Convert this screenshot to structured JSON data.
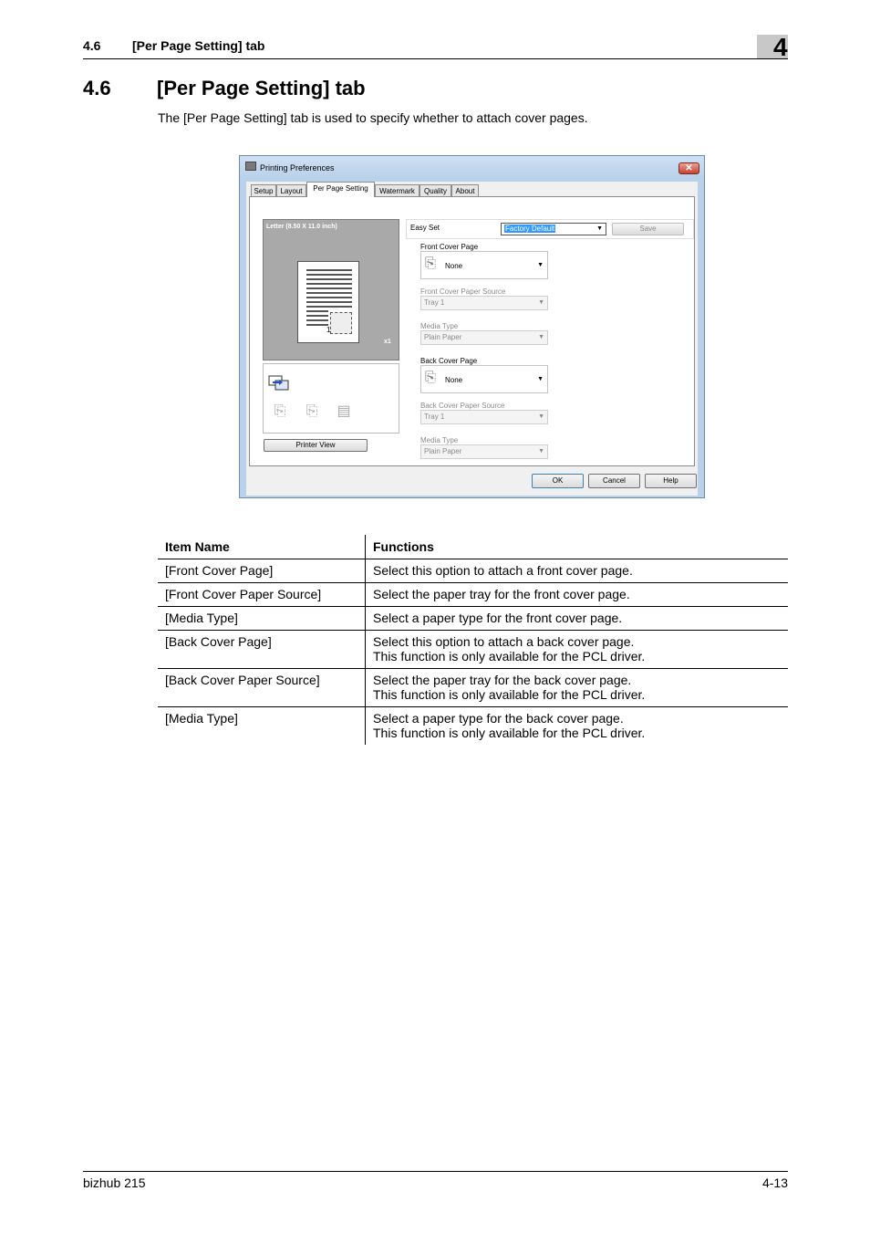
{
  "header": {
    "section_number": "4.6",
    "section_title": "[Per Page Setting] tab",
    "chapter_number": "4"
  },
  "section": {
    "number": "4.6",
    "title": "[Per Page Setting] tab",
    "intro": "The [Per Page Setting] tab is used to specify whether to attach cover pages."
  },
  "dialog": {
    "title": "Printing Preferences",
    "close_glyph": "✕",
    "tabs": [
      "Setup",
      "Layout",
      "Per Page Setting",
      "Watermark",
      "Quality",
      "About"
    ],
    "active_tab": "Per Page Setting",
    "preview": {
      "paper_label": "Letter  (8.50 X 11.0 inch)",
      "copies": "x1",
      "page_number": "1"
    },
    "printer_view_label": "Printer View",
    "easy_set_label": "Easy Set",
    "easy_set_value": "Factory Default",
    "save_label": "Save",
    "front_cover_page_label": "Front Cover Page",
    "front_cover_page_value": "None",
    "front_cover_source_label": "Front Cover Paper Source",
    "front_cover_source_value": "Tray 1",
    "front_media_type_label": "Media Type",
    "front_media_type_value": "Plain Paper",
    "back_cover_page_label": "Back Cover Page",
    "back_cover_page_value": "None",
    "back_cover_source_label": "Back Cover Paper Source",
    "back_cover_source_value": "Tray 1",
    "back_media_type_label": "Media Type",
    "back_media_type_value": "Plain Paper",
    "ok_label": "OK",
    "cancel_label": "Cancel",
    "help_label": "Help",
    "dropdown_glyph": "▼"
  },
  "table": {
    "headers": [
      "Item Name",
      "Functions"
    ],
    "rows": [
      {
        "item": "[Front Cover Page]",
        "f1": "Select this option to attach a front cover page.",
        "f2": ""
      },
      {
        "item": "[Front Cover Paper Source]",
        "f1": "Select the paper tray for the front cover page.",
        "f2": ""
      },
      {
        "item": "[Media Type]",
        "f1": "Select a paper type for the front cover page.",
        "f2": ""
      },
      {
        "item": "[Back Cover Page]",
        "f1": "Select this option to attach a back cover page.",
        "f2": "This function is only available for the PCL driver."
      },
      {
        "item": "[Back Cover Paper Source]",
        "f1": "Select the paper tray for the back cover page.",
        "f2": "This function is only available for the PCL driver."
      },
      {
        "item": "[Media Type]",
        "f1": "Select a paper type for the back cover page.",
        "f2": "This function is only available for the PCL driver."
      }
    ]
  },
  "footer": {
    "product": "bizhub 215",
    "page": "4-13"
  }
}
